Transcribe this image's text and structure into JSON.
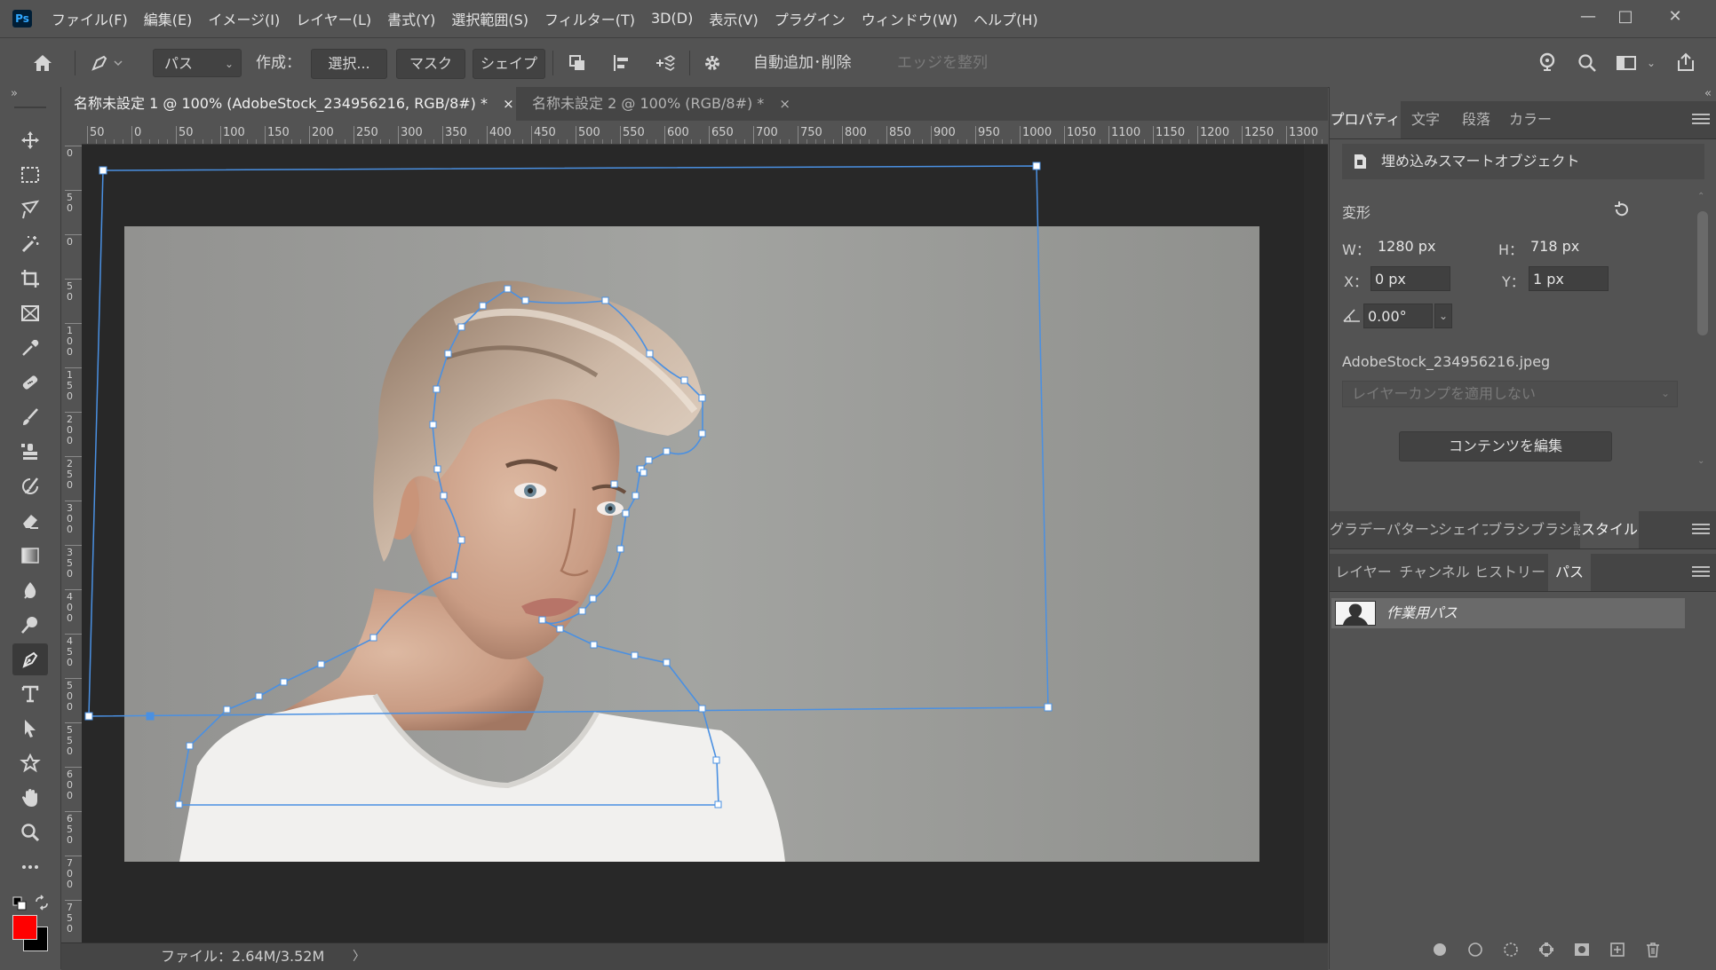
{
  "app": {
    "logo_text": "Ps",
    "menus": [
      "ファイル(F)",
      "編集(E)",
      "イメージ(I)",
      "レイヤー(L)",
      "書式(Y)",
      "選択範囲(S)",
      "フィルター(T)",
      "3D(D)",
      "表示(V)",
      "プラグイン",
      "ウィンドウ(W)",
      "ヘルプ(H)"
    ],
    "window_controls": {
      "minimize": "—",
      "maximize": "□",
      "close": "✕"
    }
  },
  "options_bar": {
    "mode_value": "パス",
    "make_label": "作成：",
    "select_button": "選択...",
    "mask_button": "マスク",
    "shape_button": "シェイプ",
    "auto_add_delete_label": "自動追加･削除",
    "auto_add_delete_checked": true,
    "align_edges_label": "エッジを整列",
    "align_edges_checked": false
  },
  "tools": [
    "move-tool",
    "marquee-tool",
    "lasso-tool",
    "magic-wand-tool",
    "crop-tool",
    "frame-tool",
    "eyedropper-tool",
    "healing-brush-tool",
    "brush-tool",
    "clone-stamp-tool",
    "history-brush-tool",
    "eraser-tool",
    "gradient-tool",
    "blur-tool",
    "dodge-tool",
    "pen-tool",
    "type-tool",
    "path-selection-tool",
    "custom-shape-tool",
    "hand-tool",
    "zoom-tool",
    "more-tools"
  ],
  "active_tool": "pen-tool",
  "colors": {
    "foreground": "#ff0000",
    "background": "#000000",
    "path_stroke": "#4a90e2",
    "accent_ui": "#535353"
  },
  "documents": [
    {
      "title": "名称未設定 1 @ 100% (AdobeStock_234956216, RGB/8#) *",
      "close": "×",
      "active": true
    },
    {
      "title": "名称未設定 2 @ 100% (RGB/8#) *",
      "close": "×",
      "active": false
    }
  ],
  "rulers": {
    "h_ticks": [
      "50",
      "0",
      "50",
      "100",
      "150",
      "200",
      "250",
      "300",
      "350",
      "400",
      "450",
      "500",
      "550",
      "600",
      "650",
      "700",
      "750",
      "800",
      "850",
      "900",
      "950",
      "1000",
      "1050",
      "1100",
      "1150",
      "1200",
      "1250",
      "1300"
    ],
    "v_ticks": [
      "0",
      "50",
      "0",
      "50",
      "100",
      "150",
      "200",
      "250",
      "300",
      "350",
      "400",
      "450",
      "500",
      "550",
      "600",
      "650",
      "700",
      "750"
    ]
  },
  "status": {
    "file_info": "ファイル：2.64M/3.52M",
    "arrow": "〉"
  },
  "properties_panel": {
    "tabs": [
      "プロパティ",
      "文字",
      "段落",
      "カラー"
    ],
    "active_tab": "プロパティ",
    "object_type": "埋め込みスマートオブジェクト",
    "transform_label": "変形",
    "w_label": "W：",
    "w_value": "1280 px",
    "h_label": "H：",
    "h_value": "718 px",
    "x_label": "X：",
    "x_value": "0 px",
    "y_label": "Y：",
    "y_value": "1 px",
    "angle_value": "0.00°",
    "filename": "AdobeStock_234956216.jpeg",
    "layer_comp_placeholder": "レイヤーカンプを適用しない",
    "edit_contents_button": "コンテンツを編集"
  },
  "styles_panel": {
    "tabs": [
      "グラデー",
      "パターン",
      "シェイプ",
      "ブラシ",
      "ブラシ設",
      "スタイル"
    ],
    "active_tab": "スタイル"
  },
  "paths_panel": {
    "tabs": [
      "レイヤー",
      "チャンネル",
      "ヒストリー",
      "パス"
    ],
    "active_tab": "パス",
    "items": [
      {
        "name": "作業用パス"
      }
    ],
    "footer_icons": [
      "fill-path-icon",
      "stroke-path-icon",
      "load-as-selection-icon",
      "make-work-path-icon",
      "add-mask-icon",
      "new-path-icon",
      "delete-path-icon"
    ]
  }
}
